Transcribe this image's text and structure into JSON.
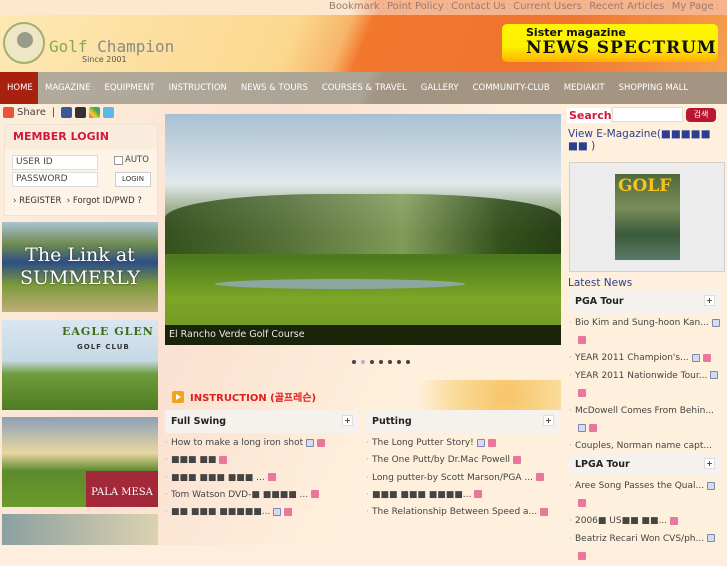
{
  "top_links": [
    "Bookmark",
    "Point Policy",
    "Contact Us",
    "Current Users",
    "Recent Articles",
    "My Page"
  ],
  "logo": {
    "name_a": "Golf",
    "name_b": "Champion",
    "since": "Since 2001"
  },
  "sister": {
    "label": "Sister magazine",
    "name": "NEWS  SPECTRUM"
  },
  "nav": [
    "HOME",
    "MAGAZINE",
    "EQUIPMENT",
    "INSTRUCTION",
    "NEWS & TOURS",
    "COURSES & TRAVEL",
    "GALLERY",
    "COMMUNITY-CLUB",
    "MEDIAKIT",
    "SHOPPING MALL"
  ],
  "share": {
    "label": "Share",
    "sep": "|"
  },
  "login": {
    "title": "MEMBER LOGIN",
    "user_placeholder": "USER ID",
    "pass_placeholder": "PASSWORD",
    "auto": "AUTO",
    "button": "LOGIN",
    "register": "REGISTER",
    "forgot": "Forgot ID/PWD ?"
  },
  "banners": {
    "b1": "The Link at SUMMERLY",
    "b2a": "EAGLE GLEN",
    "b2b": "GOLF CLUB",
    "b3": "PALA MESA"
  },
  "slider": {
    "caption": "El Rancho Verde Golf Course",
    "slides": 7,
    "active": 2
  },
  "instruction": {
    "title": "INSTRUCTION (골프레슨)",
    "full_swing": {
      "title": "Full Swing",
      "items": [
        {
          "t": "How to make a long iron shot",
          "b": true,
          "p": true
        },
        {
          "t": "■■■ ■■",
          "b": false,
          "p": true
        },
        {
          "t": "■■■ ■■■ ■■■ ...",
          "b": false,
          "p": true
        },
        {
          "t": "Tom Watson DVD-■ ■■■■ ...",
          "b": false,
          "p": true
        },
        {
          "t": "■■ ■■■ ■■■■■...",
          "b": true,
          "p": true
        }
      ]
    },
    "putting": {
      "title": "Putting",
      "items": [
        {
          "t": "The Long Putter Story!",
          "b": true,
          "p": true
        },
        {
          "t": "The One Putt/by Dr.Mac Powell",
          "b": false,
          "p": true
        },
        {
          "t": "Long putter-by Scott Marson/PGA ...",
          "b": false,
          "p": true
        },
        {
          "t": "■■■ ■■■ ■■■■...",
          "b": false,
          "p": true
        },
        {
          "t": "The Relationship Between Speed a...",
          "b": false,
          "p": true
        }
      ]
    }
  },
  "search": {
    "label": "Search",
    "button": "검색"
  },
  "emagazine": "View E-Magazine(■■■■■ ■■ )",
  "magazine_cover": "GOLF",
  "latest": {
    "title": "Latest News",
    "pga": {
      "title": "PGA Tour",
      "items": [
        {
          "t": "Bio Kim and Sung-hoon Kan...",
          "b": true,
          "p": true
        },
        {
          "t": "YEAR 2011 Champion's...",
          "b": true,
          "p": true
        },
        {
          "t": "YEAR 2011 Nationwide Tour...",
          "b": true,
          "p": true
        },
        {
          "t": "McDowell Comes From Behin...",
          "b": true,
          "p": true
        },
        {
          "t": "Couples, Norman name capt...",
          "b": false,
          "p": true
        }
      ]
    },
    "lpga": {
      "title": "LPGA Tour",
      "items": [
        {
          "t": "Aree Song Passes the Qual...",
          "b": true,
          "p": true
        },
        {
          "t": "2006■ US■■ ■■...",
          "b": false,
          "p": true
        },
        {
          "t": "Beatriz Recari Won CVS/ph...",
          "b": true,
          "p": true
        }
      ]
    }
  },
  "plus": "+"
}
